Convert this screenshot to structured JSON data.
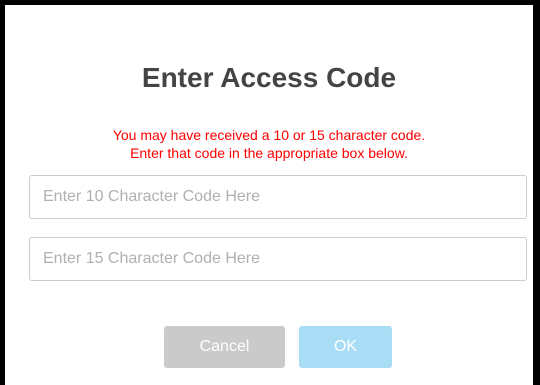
{
  "dialog": {
    "title": "Enter Access Code",
    "message_line1": "You may have received a 10 or 15 character code.",
    "message_line2": "Enter that code in the appropriate box below.",
    "code10": {
      "placeholder": "Enter 10 Character Code Here",
      "value": ""
    },
    "code15": {
      "placeholder": "Enter 15 Character Code Here",
      "value": ""
    },
    "cancel_label": "Cancel",
    "ok_label": "OK"
  },
  "colors": {
    "title": "#444444",
    "message": "#ff0000",
    "cancel_bg": "#cacaca",
    "ok_bg": "#a9dcf5",
    "frame_border": "#000000"
  }
}
